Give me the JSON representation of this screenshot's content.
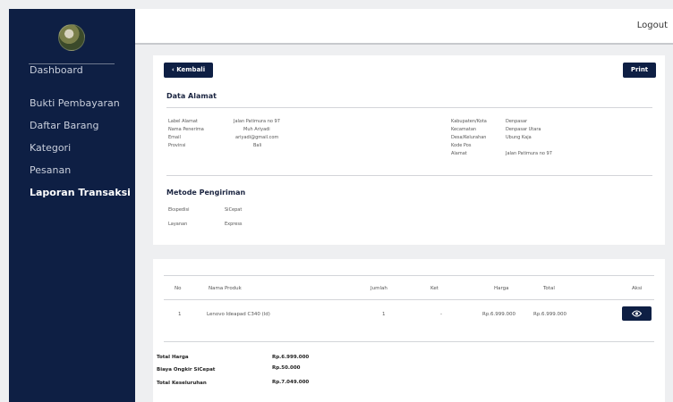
{
  "sidebar": {
    "items": [
      {
        "label": "Dashboard"
      },
      {
        "label": "Bukti Pembayaran"
      },
      {
        "label": "Daftar Barang"
      },
      {
        "label": "Kategori"
      },
      {
        "label": "Pesanan"
      },
      {
        "label": "Laporan Transaksi"
      }
    ]
  },
  "topbar": {
    "logout": "Logout"
  },
  "detail": {
    "back_label": "‹ Kembali",
    "print_label": "Print",
    "address_title": "Data Alamat",
    "address_left": [
      {
        "label": "Label Alamat",
        "value": "Jalan Patimura no 97"
      },
      {
        "label": "Nama Penerima",
        "value": "Muh Ariyadi"
      },
      {
        "label": "Email",
        "value": "ariyadi@gmail.com"
      },
      {
        "label": "Provinsi",
        "value": "Bali"
      }
    ],
    "address_right": [
      {
        "label": "Kabupaten/Kota",
        "value": "Denpasar"
      },
      {
        "label": "Kecamatan",
        "value": "Denpasar Utara"
      },
      {
        "label": "Desa/Kelurahan",
        "value": "Ubung Kaja"
      },
      {
        "label": "Kode Pos",
        "value": ""
      },
      {
        "label": "Alamat",
        "value": "Jalan Patimura no 97"
      }
    ],
    "shipping_title": "Metode Pengiriman",
    "shipping": [
      {
        "label": "Ekspedisi",
        "value": "SiCepat"
      },
      {
        "label": "Layanan",
        "value": "Express"
      }
    ]
  },
  "orders": {
    "columns": [
      "No",
      "Nama Produk",
      "Jumlah",
      "Ket",
      "Harga",
      "Total",
      "Aksi"
    ],
    "rows": [
      {
        "no": "1",
        "product": "Lenovo Ideapad C340 (ld)",
        "qty": "1",
        "note": "-",
        "price": "Rp.6.999.000",
        "total": "Rp.6.999.000"
      }
    ],
    "action_icon": "eye-icon",
    "summary": [
      {
        "label": "Total Harga",
        "value": "Rp.6.999.000"
      },
      {
        "label": "Biaya Ongkir SiCepat",
        "value": "Rp.50.000"
      },
      {
        "label": "Total Keseluruhan",
        "value": "Rp.7.049.000"
      }
    ]
  },
  "colors": {
    "sidebar": "#0e1f44",
    "background": "#eeeff1",
    "card": "#ffffff",
    "accent": "#0e1f44"
  }
}
